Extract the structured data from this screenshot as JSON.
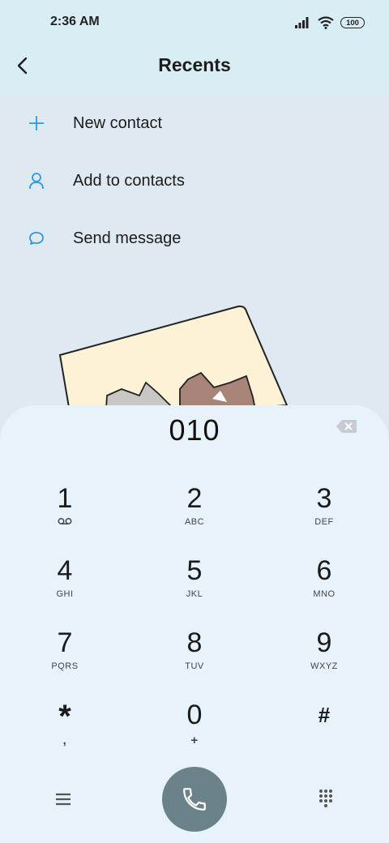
{
  "status": {
    "time": "2:36 AM",
    "battery": "100"
  },
  "header": {
    "title": "Recents"
  },
  "actions": [
    {
      "label": "New contact",
      "icon": "plus-icon"
    },
    {
      "label": "Add to contacts",
      "icon": "person-icon"
    },
    {
      "label": "Send message",
      "icon": "chat-bubble-icon"
    }
  ],
  "dialer": {
    "number": "010",
    "keys": [
      {
        "digit": "1",
        "letters": ""
      },
      {
        "digit": "2",
        "letters": "ABC"
      },
      {
        "digit": "3",
        "letters": "DEF"
      },
      {
        "digit": "4",
        "letters": "GHI"
      },
      {
        "digit": "5",
        "letters": "JKL"
      },
      {
        "digit": "6",
        "letters": "MNO"
      },
      {
        "digit": "7",
        "letters": "PQRS"
      },
      {
        "digit": "8",
        "letters": "TUV"
      },
      {
        "digit": "9",
        "letters": "WXYZ"
      },
      {
        "digit": "*",
        "letters": ","
      },
      {
        "digit": "0",
        "letters": "+"
      },
      {
        "digit": "#",
        "letters": ""
      }
    ]
  },
  "colors": {
    "accent": "#2a9be0",
    "call_button": "#6a8289",
    "dialer_bg": "#e7f2fa"
  }
}
